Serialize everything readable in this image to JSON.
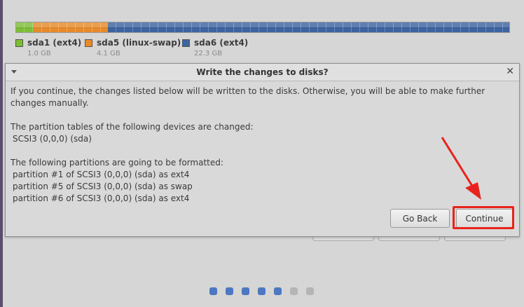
{
  "partitions": [
    {
      "name": "sda1 (ext4)",
      "size": "1.0 GB",
      "color": "#7ebc37"
    },
    {
      "name": "sda5 (linux-swap)",
      "size": "4.1 GB",
      "color": "#e78a2a"
    },
    {
      "name": "sda6 (ext4)",
      "size": "22.3 GB",
      "color": "#3d63a0"
    }
  ],
  "dialog": {
    "title": "Write the changes to disks?",
    "intro": "If you continue, the changes listed below will be written to the disks. Otherwise, you will be able to make further changes manually.",
    "tables_heading": "The partition tables of the following devices are changed:",
    "tables_devices": [
      "SCSI3 (0,0,0) (sda)"
    ],
    "format_heading": "The following partitions are going to be formatted:",
    "format_items": [
      "partition #1 of SCSI3 (0,0,0) (sda) as ext4",
      "partition #5 of SCSI3 (0,0,0) (sda) as swap",
      "partition #6 of SCSI3 (0,0,0) (sda) as ext4"
    ],
    "go_back_label": "Go Back",
    "continue_label": "Continue"
  },
  "progress": {
    "total_steps": 7,
    "completed_steps": 5,
    "active_color": "#4a78c4",
    "inactive_color": "#b5b5b5"
  },
  "annotation_color": "#e8231c"
}
